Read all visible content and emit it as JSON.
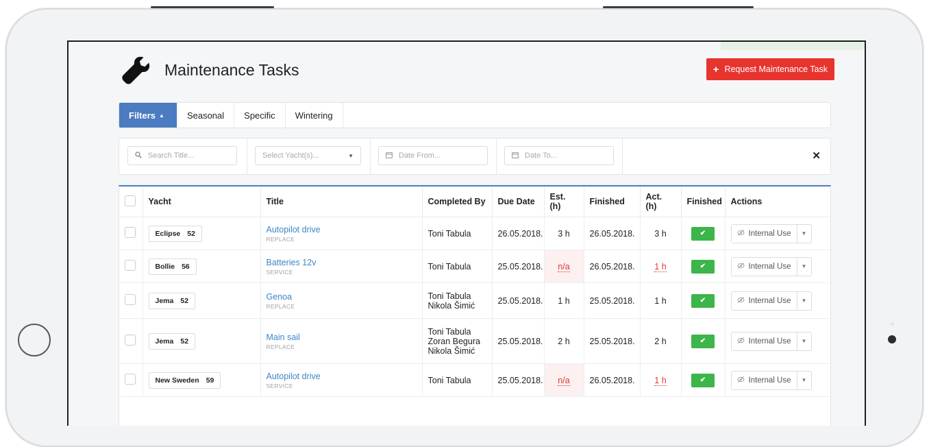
{
  "header": {
    "title": "Maintenance Tasks",
    "request_button_label": "Request Maintenance Task"
  },
  "tabs": [
    {
      "label": "Filters",
      "active": true
    },
    {
      "label": "Seasonal",
      "active": false
    },
    {
      "label": "Specific",
      "active": false
    },
    {
      "label": "Wintering",
      "active": false
    }
  ],
  "filters": {
    "search_placeholder": "Search Title...",
    "yacht_placeholder": "Select Yacht(s)...",
    "date_from_placeholder": "Date From...",
    "date_to_placeholder": "Date To..."
  },
  "table": {
    "columns": [
      "Yacht",
      "Title",
      "Completed By",
      "Due Date",
      "Est. (h)",
      "Finished",
      "Act. (h)",
      "Finished",
      "Actions"
    ],
    "rows": [
      {
        "yacht": "Eclipse",
        "yacht_size": "52",
        "title": "Autopilot drive",
        "type": "REPLACE",
        "completed_by": [
          "Toni Tabula"
        ],
        "due_date": "26.05.2018.",
        "est": "3 h",
        "est_na": false,
        "finished_date": "26.05.2018.",
        "act": "3 h",
        "act_red": false,
        "action_label": "Internal Use"
      },
      {
        "yacht": "Bollie",
        "yacht_size": "56",
        "title": "Batteries 12v",
        "type": "SERVICE",
        "completed_by": [
          "Toni Tabula"
        ],
        "due_date": "25.05.2018.",
        "est": "n/a",
        "est_na": true,
        "finished_date": "26.05.2018.",
        "act": "1 h",
        "act_red": true,
        "action_label": "Internal Use"
      },
      {
        "yacht": "Jema",
        "yacht_size": "52",
        "title": "Genoa",
        "type": "REPLACE",
        "completed_by": [
          "Toni Tabula",
          "Nikola Šimić"
        ],
        "due_date": "25.05.2018.",
        "est": "1 h",
        "est_na": false,
        "finished_date": "25.05.2018.",
        "act": "1 h",
        "act_red": false,
        "action_label": "Internal Use"
      },
      {
        "yacht": "Jema",
        "yacht_size": "52",
        "title": "Main sail",
        "type": "REPLACE",
        "completed_by": [
          "Toni Tabula",
          "Zoran Begura",
          "Nikola Šimić"
        ],
        "due_date": "25.05.2018.",
        "est": "2 h",
        "est_na": false,
        "finished_date": "25.05.2018.",
        "act": "2 h",
        "act_red": false,
        "action_label": "Internal Use"
      },
      {
        "yacht": "New Sweden",
        "yacht_size": "59",
        "title": "Autopilot drive",
        "type": "SERVICE",
        "completed_by": [
          "Toni Tabula"
        ],
        "due_date": "25.05.2018.",
        "est": "n/a",
        "est_na": true,
        "finished_date": "26.05.2018.",
        "act": "1 h",
        "act_red": true,
        "action_label": "Internal Use"
      }
    ]
  },
  "icons": {
    "header": "wrench-icon",
    "request": "plus-icon",
    "search": "search-icon",
    "calendar": "calendar-icon",
    "clear": "close-icon",
    "finished": "check-icon",
    "action": "eye-slash-icon"
  },
  "colors": {
    "primary": "#4b7bc0",
    "danger": "#e8342e",
    "success": "#3cb54a",
    "link": "#3d86c6"
  }
}
